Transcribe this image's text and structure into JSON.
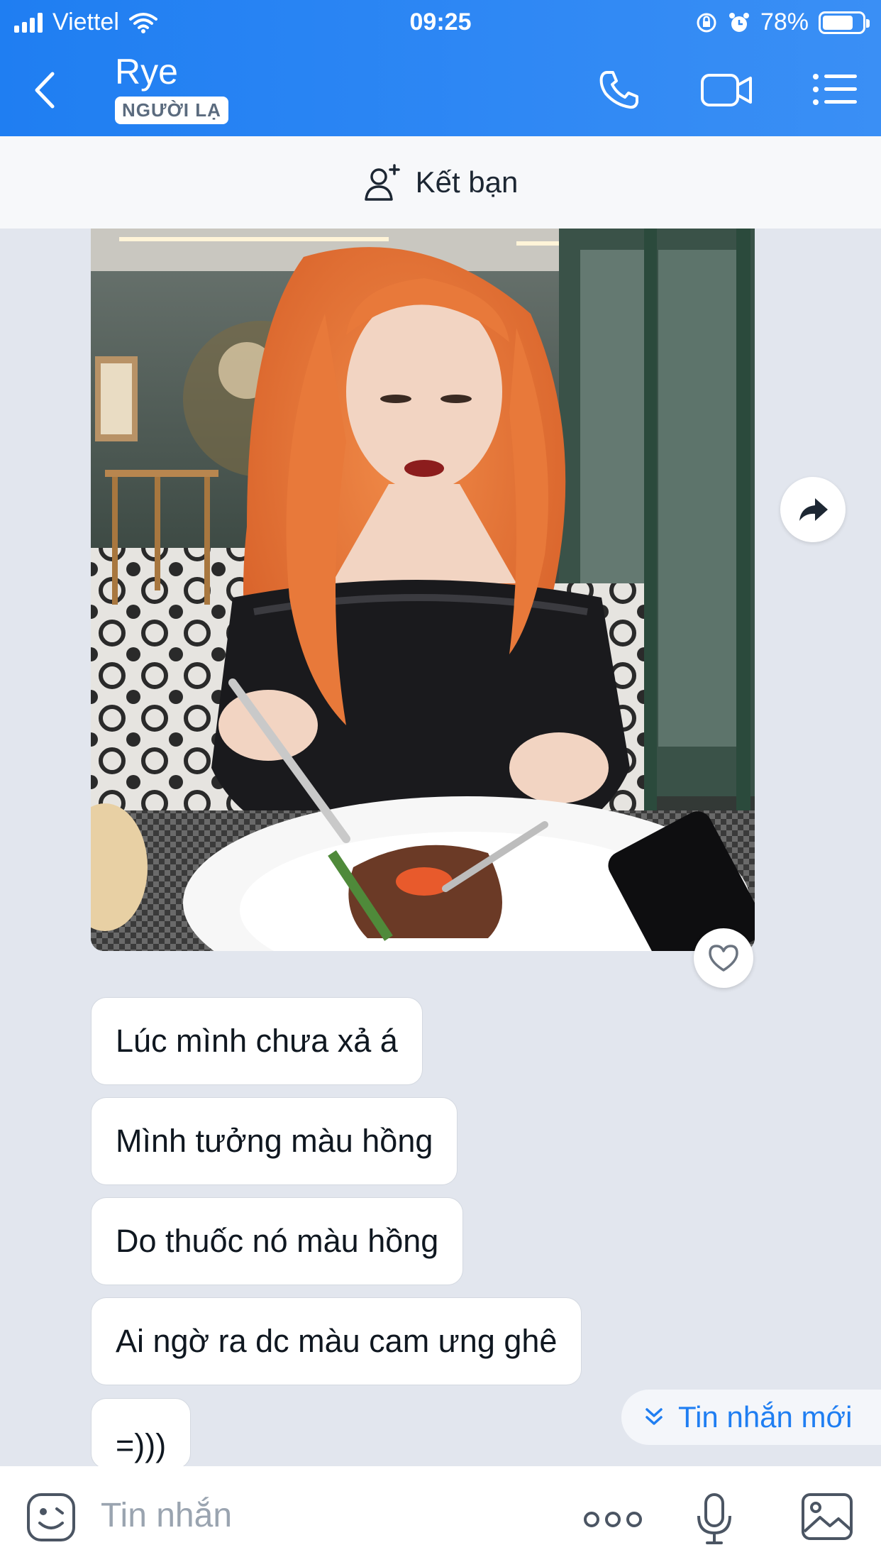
{
  "status_bar": {
    "carrier": "Viettel",
    "time": "09:25",
    "battery": "78%"
  },
  "header": {
    "title": "Rye",
    "badge": "NGƯỜI LẠ",
    "icons": [
      "back-icon",
      "phone-icon",
      "video-call-icon",
      "menu-list-icon"
    ]
  },
  "friend_bar": {
    "label": "Kết bạn",
    "icon": "add-friend-icon"
  },
  "messages": [
    {
      "text": "Lúc mình chưa xả á"
    },
    {
      "text": "Mình tưởng màu hồng"
    },
    {
      "text": "Do thuốc nó màu hồng"
    },
    {
      "text": "Ai ngờ ra dc màu cam ưng ghê"
    },
    {
      "text": "=)))"
    }
  ],
  "new_message_pill": {
    "label": "Tin nhắn mới",
    "icon": "double-chevron-down-icon"
  },
  "input_bar": {
    "placeholder": "Tin nhắn",
    "icons": [
      "sticker-icon",
      "more-icon",
      "microphone-icon",
      "image-icon"
    ]
  },
  "colors": {
    "header": "#2a86f3",
    "accent": "#1f7ef2",
    "chat_background": "#e2e6ee",
    "hair": "#e8793a"
  }
}
